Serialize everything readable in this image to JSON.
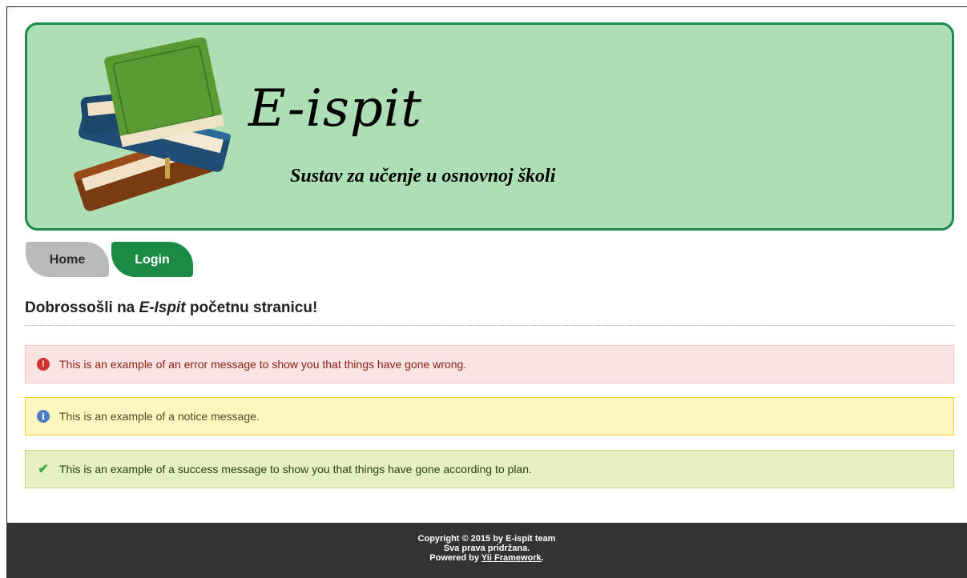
{
  "header": {
    "title": "E-ispit",
    "subtitle": "Sustav za učenje u osnovnoj školi",
    "logo_icon": "books-icon"
  },
  "nav": {
    "items": [
      {
        "label": "Home",
        "color": "#b8bab9"
      },
      {
        "label": "Login",
        "color": "#1a8a45"
      }
    ]
  },
  "page": {
    "title_prefix": "Dobrossošli na ",
    "title_emphasis": "E-Ispit",
    "title_suffix": " početnu stranicu!"
  },
  "flashes": {
    "error": {
      "text": "This is an example of an error message to show you that things have gone wrong.",
      "icon": "error-icon"
    },
    "notice": {
      "text": "This is an example of a notice message.",
      "icon": "info-icon"
    },
    "success": {
      "text": "This is an example of a success message to show you that things have gone according to plan.",
      "icon": "checkmark-icon"
    }
  },
  "footer": {
    "copyright": "Copyright © 2015 by E-ispit team",
    "rights": "Sva prava pridržana.",
    "powered_prefix": "Powered by ",
    "powered_link": "Yii Framework",
    "powered_suffix": "."
  },
  "colors": {
    "header_bg": "#aedfb4",
    "header_border": "#1c8a4a",
    "footer_bg": "#333333"
  }
}
